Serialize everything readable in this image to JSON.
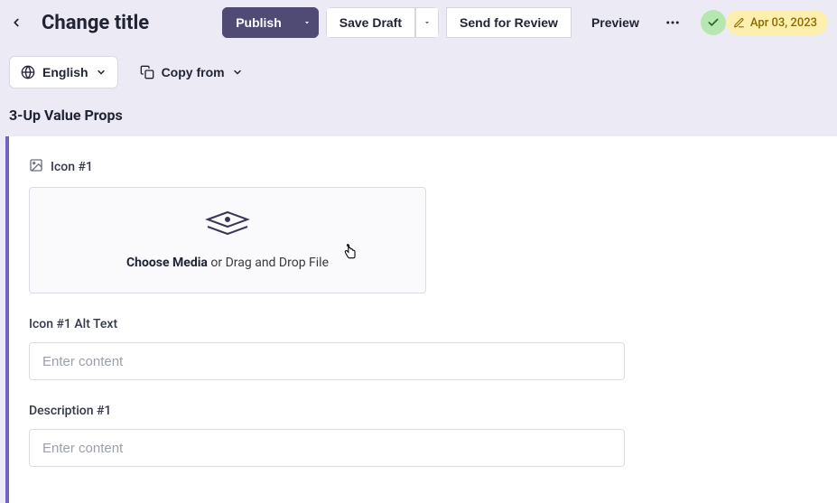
{
  "header": {
    "title": "Change title",
    "publish_label": "Publish",
    "save_draft_label": "Save Draft",
    "send_review_label": "Send for Review",
    "preview_label": "Preview",
    "status_date": "Apr 03, 2023"
  },
  "subbar": {
    "language_label": "English",
    "copy_from_label": "Copy from"
  },
  "section": {
    "title": "3-Up Value Props"
  },
  "fields": {
    "icon1": {
      "label": "Icon #1",
      "choose_media_strong": "Choose Media",
      "choose_media_rest": " or Drag and Drop File"
    },
    "alt1": {
      "label": "Icon #1 Alt Text",
      "placeholder": "Enter content",
      "value": ""
    },
    "desc1": {
      "label": "Description #1",
      "placeholder": "Enter content",
      "value": ""
    }
  }
}
